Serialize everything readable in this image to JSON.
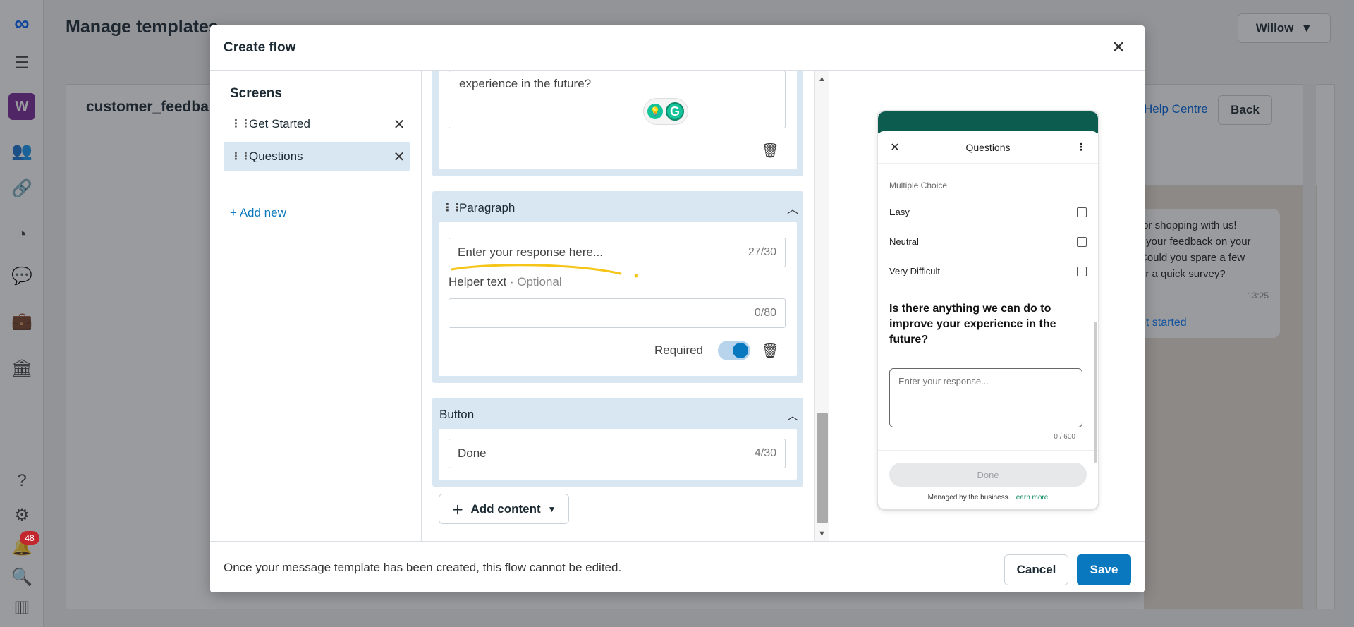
{
  "background": {
    "page_title": "Manage templates",
    "user_menu": "Willow",
    "card_title": "customer_feedba",
    "help_link": "Help Centre",
    "back_button": "Back",
    "notifications_count": "48",
    "workspace_initial": "W",
    "preview_bubble_lines": [
      "for shopping with us!",
      "r your feedback on your",
      "Could you spare a few",
      "er a quick survey?"
    ],
    "preview_bubble_time": "13:25",
    "preview_bubble_link": "et started"
  },
  "modal": {
    "title": "Create flow",
    "footer_note": "Once your message template has been created, this flow cannot be edited.",
    "cancel_label": "Cancel",
    "save_label": "Save"
  },
  "screens": {
    "heading": "Screens",
    "items": [
      {
        "label": "Get Started",
        "selected": false
      },
      {
        "label": "Questions",
        "selected": true
      }
    ],
    "add_new": "+ Add new"
  },
  "editor": {
    "textarea_value": "experience in the future?",
    "paragraph": {
      "header": "Paragraph",
      "placeholder_value": "Enter your response here...",
      "placeholder_count": "27/30",
      "helper_label": "Helper text",
      "helper_optional": "· Optional",
      "helper_value": "",
      "helper_count": "0/80",
      "required_label": "Required",
      "required_on": true
    },
    "button": {
      "header": "Button",
      "value": "Done",
      "count": "4/30"
    },
    "add_content": "Add content"
  },
  "preview": {
    "title": "Questions",
    "section_label": "Multiple Choice",
    "options": [
      "Easy",
      "Neutral",
      "Very Difficult"
    ],
    "question": "Is there anything we can do to improve your experience in the future?",
    "textarea_placeholder": "Enter your response...",
    "char_count": "0 / 600",
    "done_label": "Done",
    "footer_text": "Managed by the business.",
    "footer_link": "Learn more"
  },
  "colors": {
    "accent": "#0a78be",
    "section_bg": "#d9e7f3",
    "whatsapp_green": "#0c5d4f"
  }
}
